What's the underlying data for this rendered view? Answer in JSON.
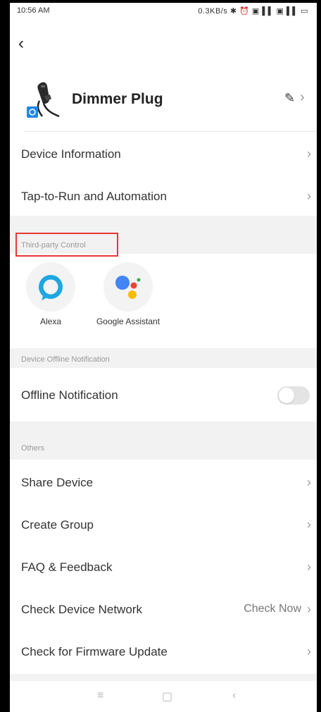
{
  "status_bar": {
    "time": "10:56 AM",
    "indicators": "0.3KB/s ✱ ⏰ ▣ ▌▌ ▣ ▌▌ ▭"
  },
  "navigation": {
    "back_icon": "‹"
  },
  "device": {
    "name": "Dimmer Plug",
    "edit_icon": "✎",
    "chevron": "›"
  },
  "menu_top": [
    {
      "label": "Device Information",
      "chevron": "›"
    },
    {
      "label": "Tap-to-Run and Automation",
      "chevron": "›"
    }
  ],
  "third_party": {
    "section_title": "Third-party Control",
    "highlight_color": "#e53935",
    "items": [
      {
        "name": "Alexa",
        "icon": "alexa-icon",
        "color": "#1ea7e1"
      },
      {
        "name": "Google Assistant",
        "icon": "google-assistant-icon",
        "colors": [
          "#4285f4",
          "#ea4335",
          "#fbbc05",
          "#34a853"
        ]
      }
    ]
  },
  "offline": {
    "section_title": "Device Offline Notification",
    "label": "Offline Notification",
    "enabled": false
  },
  "others": {
    "section_title": "Others",
    "items": [
      {
        "label": "Share Device",
        "right_text": "",
        "chevron": "›"
      },
      {
        "label": "Create Group",
        "right_text": "",
        "chevron": "›"
      },
      {
        "label": "FAQ & Feedback",
        "right_text": "",
        "chevron": "›"
      },
      {
        "label": "Check Device Network",
        "right_text": "Check Now",
        "chevron": "›"
      },
      {
        "label": "Check for Firmware Update",
        "right_text": "",
        "chevron": "›"
      }
    ]
  },
  "system_nav": {
    "menu_icon": "≡",
    "home_icon": "▢",
    "back_icon": "‹"
  }
}
